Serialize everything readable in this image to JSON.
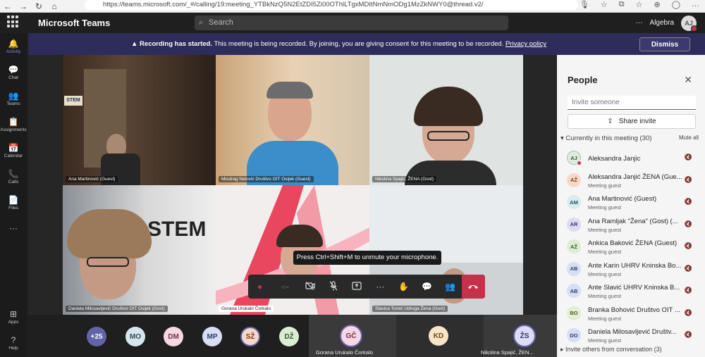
{
  "browser": {
    "url": "https://teams.microsoft.com/_#/calling/19:meeting_YTBkNzQ5N2EtZDI5Zi00OThlLTgxMDItNmNmODg1MzZkNWY0@thread.v2/",
    "back": "←",
    "forward": "→",
    "reload": "↻",
    "home": "⌂",
    "icons": [
      "🎙",
      "☆",
      "⧉",
      "☆",
      "⊕",
      "◯",
      "…"
    ]
  },
  "titlebar": {
    "app_name": "Microsoft Teams",
    "search_placeholder": "Search",
    "more": "···",
    "org": "Algebra",
    "user_initials": "AJ"
  },
  "rail": [
    {
      "label": "Activity",
      "icon": "🔔"
    },
    {
      "label": "Chat",
      "icon": "💬"
    },
    {
      "label": "Teams",
      "icon": "👥"
    },
    {
      "label": "Assignments",
      "icon": "📋"
    },
    {
      "label": "Calendar",
      "icon": "📅"
    },
    {
      "label": "Calls",
      "icon": "📞"
    },
    {
      "label": "Files",
      "icon": "📄"
    },
    {
      "label": "",
      "icon": "···"
    }
  ],
  "rail_bottom": [
    {
      "label": "Apps",
      "icon": "⊞"
    },
    {
      "label": "Help",
      "icon": "?"
    }
  ],
  "banner": {
    "bold": "Recording has started.",
    "text": "This meeting is being recorded. By joining, you are giving consent for this meeting to be recorded.",
    "link": "Privacy policy",
    "dismiss": "Dismiss",
    "warn_icon": "▲"
  },
  "tiles": [
    {
      "name": "Ana Martinović (Guest)"
    },
    {
      "name": "Miodrag Nelović Društvo OIT Osijek (Guest)"
    },
    {
      "name": "Nikolina Spajić, ŽENA (Gost)"
    },
    {
      "name": "Daniela Milosavljević Društvo OIT Osijek (Gost)"
    },
    {
      "name": "Gorana Urukalo Čorkalo"
    },
    {
      "name": "Slavica Tomić Udruga Žena (Gost)"
    }
  ],
  "tile_text": {
    "stem1": "STEM",
    "stem2": "STEM"
  },
  "tooltip": "Press Ctrl+Shift+M to unmute your microphone.",
  "controls": {
    "record": "●",
    "timer": "-:--",
    "camera": "🚫",
    "mic": "🎙",
    "share": "⇧",
    "more": "···",
    "raise": "✋",
    "chat": "💬",
    "people": "👥",
    "hangup": "☎"
  },
  "strip": {
    "avatars": [
      {
        "initials": "+25",
        "color": "#6264a7",
        "text": "#ffffff"
      },
      {
        "initials": "MO",
        "color": "#d5e6ef",
        "text": "#3a4a55"
      },
      {
        "initials": "DM",
        "color": "#f6d7e3",
        "text": "#6a3450"
      },
      {
        "initials": "MP",
        "color": "#d6dff3",
        "text": "#333f66"
      },
      {
        "initials": "SŽ",
        "color": "#f8d9c7",
        "text": "#7a3b1a"
      },
      {
        "initials": "DŽ",
        "color": "#dbeed3",
        "text": "#3b5a2f"
      }
    ],
    "tiles": [
      {
        "initials": "GČ",
        "name": "Gorana Urukalo Čorkalo",
        "color": "#f6d7e3",
        "text": "#6a3450"
      },
      {
        "initials": "KD",
        "name": "",
        "color": "#f8e5c7",
        "text": "#6a4a1a"
      },
      {
        "initials": "ŽS",
        "name": "Nikolina Spajić, ŽEN...",
        "color": "#dcdcf5",
        "text": "#333366"
      }
    ]
  },
  "people": {
    "title": "People",
    "close": "✕",
    "invite_placeholder": "Invite someone",
    "share_invite": "Share invite",
    "share_icon": "⇪",
    "section": "Currently in this meeting (30)",
    "mute_all": "Mute all",
    "footer": "Invite others from conversation (3)",
    "mic_icon": "🔇",
    "list": [
      {
        "initials": "AJ",
        "name": "Aleksandra Janjic",
        "sub": "",
        "color": "#dcebdc",
        "text": "#3b5a2f"
      },
      {
        "initials": "AŽ",
        "name": "Aleksandra Janjić ŽENA (Gue...",
        "sub": "Meeting guest",
        "color": "#f8d9c7",
        "text": "#7a3b1a"
      },
      {
        "initials": "AM",
        "name": "Ana Martinović (Guest)",
        "sub": "Meeting guest",
        "color": "#d6ecef",
        "text": "#2f5158"
      },
      {
        "initials": "AR",
        "name": "Ana Ramljak \"Žena\" (Gost) (...",
        "sub": "Meeting guest",
        "color": "#dcdcf0",
        "text": "#3a3a66"
      },
      {
        "initials": "AŽ",
        "name": "Ankica Baković ŽENA (Guest)",
        "sub": "Meeting guest",
        "color": "#dbeed3",
        "text": "#3b5a2f"
      },
      {
        "initials": "AB",
        "name": "Ante Karin UHRV Kninska Bo...",
        "sub": "Meeting guest",
        "color": "#d6dff3",
        "text": "#333f66"
      },
      {
        "initials": "AB",
        "name": "Ante Slavić UHRV Kninska B...",
        "sub": "Meeting guest",
        "color": "#d6dff3",
        "text": "#333f66"
      },
      {
        "initials": "BO",
        "name": "Branka Bohović Društvo OIT ...",
        "sub": "Meeting guest",
        "color": "#e3eed3",
        "text": "#4a5a2f"
      },
      {
        "initials": "DO",
        "name": "Daniela Milosavljević Društv...",
        "sub": "Meeting guest",
        "color": "#d6dff3",
        "text": "#333f66"
      }
    ]
  }
}
